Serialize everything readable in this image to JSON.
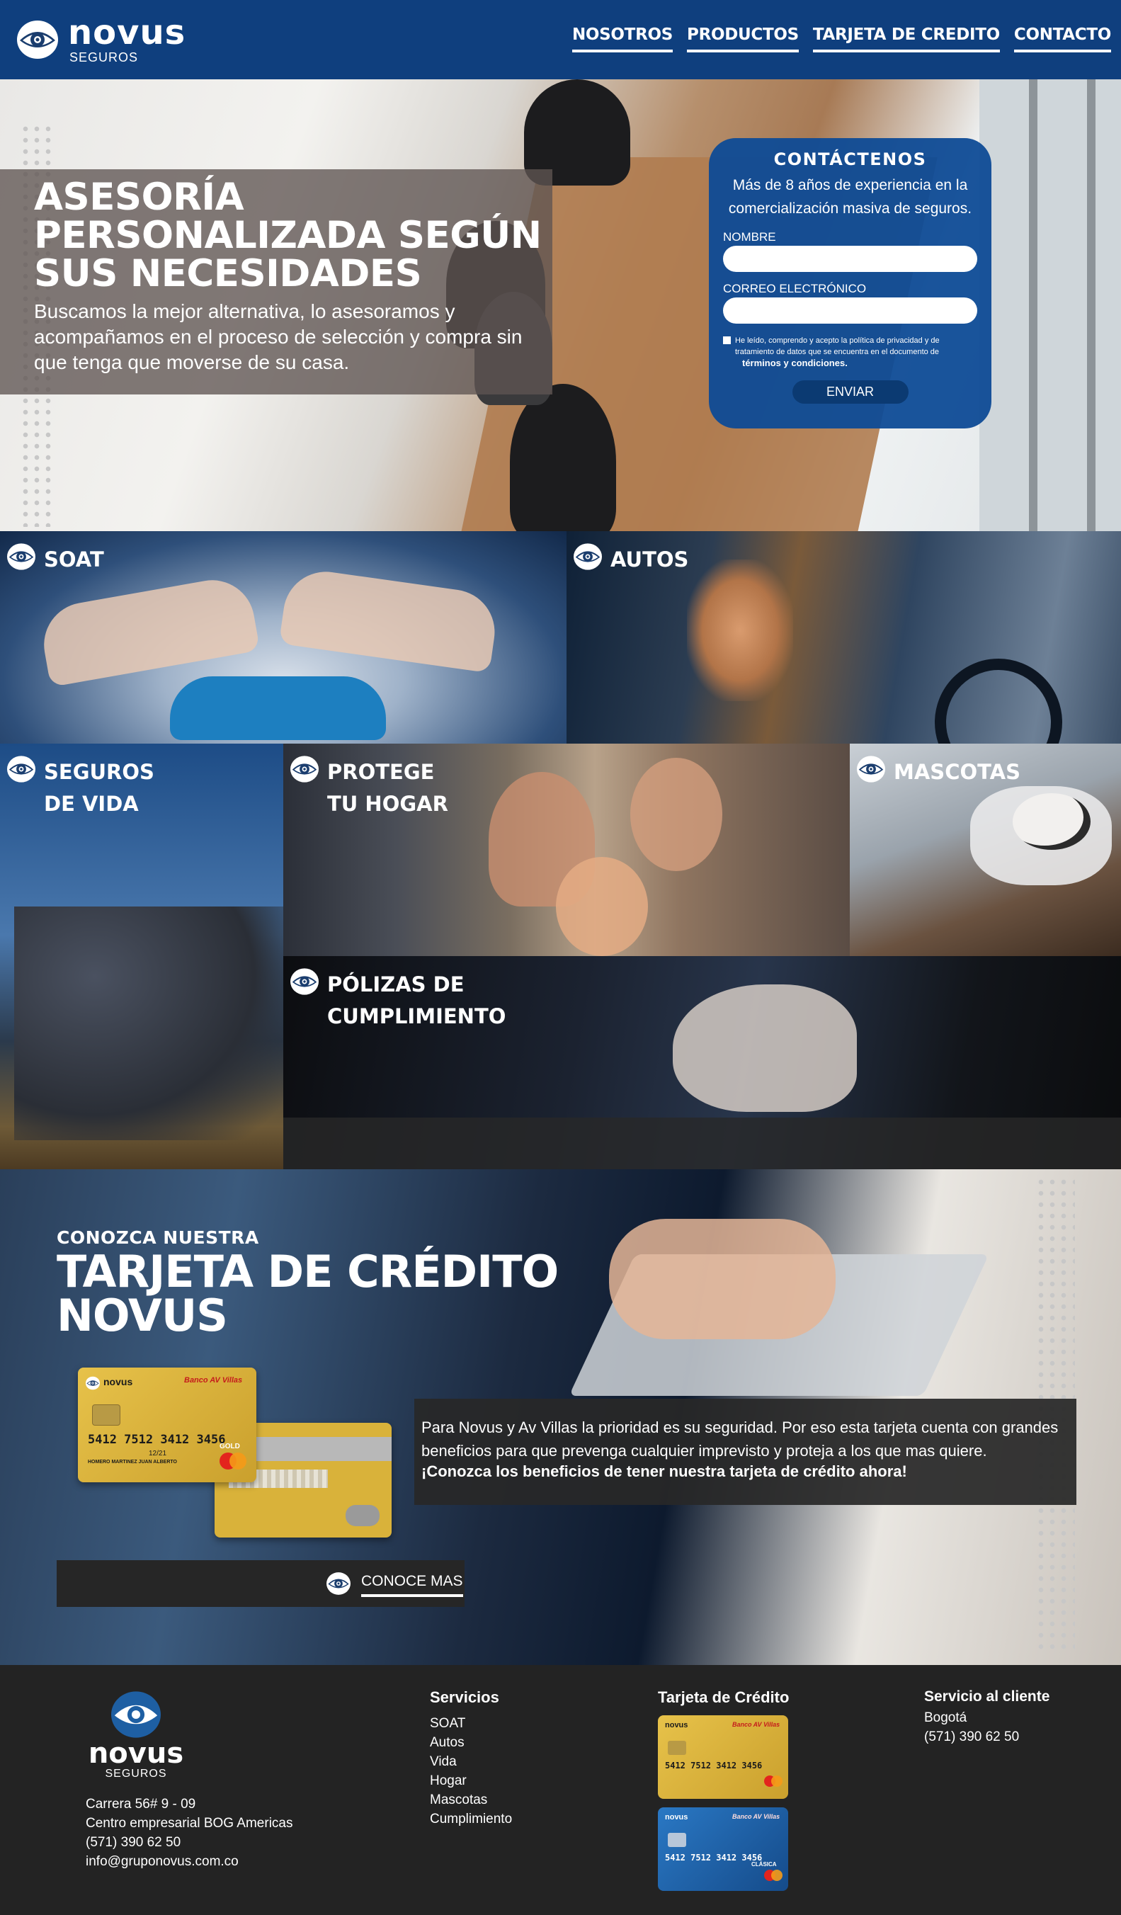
{
  "header": {
    "brand": "novus",
    "brand_sub": "SEGUROS",
    "nav": [
      "NOSOTROS",
      "PRODUCTOS",
      "TARJETA DE CREDITO",
      "CONTACTO"
    ]
  },
  "hero": {
    "title": "ASESORÍA PERSONALIZADA SEGÚN SUS NECESIDADES",
    "description": "Buscamos la mejor alternativa, lo asesoramos y acompañamos en el proceso de selección y compra sin que tenga que moverse de su casa."
  },
  "contact_form": {
    "title": "CONTÁCTENOS",
    "subtitle": "Más de 8 años de experiencia en la comercialización masiva de seguros.",
    "name_label": "NOMBRE",
    "email_label": "CORREO ELECTRÓNICO",
    "consent_text": "He leído, comprendo y acepto la política de privacidad y de tratamiento de datos que se encuentra en el documento de",
    "consent_link": "términos y condiciones.",
    "submit_label": "ENVIAR"
  },
  "products": {
    "soat": "SOAT",
    "autos": "AUTOS",
    "vida": [
      "SEGUROS",
      "DE VIDA"
    ],
    "hogar": [
      "PROTEGE",
      "TU HOGAR"
    ],
    "mascotas": "MASCOTAS",
    "cumplimiento": [
      "PÓLIZAS DE",
      "CUMPLIMIENTO"
    ]
  },
  "credit_card": {
    "pre_title": "CONOZCA NUESTRA",
    "title_line1": "TARJETA DE CRÉDITO",
    "title_line2": "NOVUS",
    "description": "Para Novus y Av Villas la prioridad es su seguridad. Por eso esta tarjeta cuenta con grandes beneficios para que prevenga cualquier imprevisto y proteja a los que mas quiere.",
    "cta_text": "¡Conozca los beneficios de tener nuestra tarjeta de crédito ahora!",
    "button_label": "CONOCE MAS",
    "card_number": "5412 7512 3412 3456",
    "card_expiry": "12/21",
    "card_holder": "HOMERO MARTINEZ JUAN ALBERTO",
    "card_tier_gold": "GOLD",
    "card_tier_classic": "CLÁSICA",
    "card_brand": "Banco AV Villas",
    "card_network": "mastercard"
  },
  "footer": {
    "brand": "novus",
    "brand_sub": "SEGUROS",
    "address_lines": [
      "Carrera 56# 9 - 09",
      "Centro empresarial BOG Americas",
      "(571) 390 62 50",
      "info@gruponovus.com.co"
    ],
    "servicios_title": "Servicios",
    "servicios": [
      "SOAT",
      "Autos",
      "Vida",
      "Hogar",
      "Mascotas",
      "Cumplimiento"
    ],
    "tarjeta_title": "Tarjeta de Crédito",
    "cliente_title": "Servicio al cliente",
    "cliente_lines": [
      "Bogotá",
      "(571) 390 62 50"
    ]
  },
  "colors": {
    "primary": "#0f3f7e",
    "form_bg": "#0e4b96",
    "dark": "#232323",
    "gold_card": "#d9b23a",
    "blue_card": "#1b5fa8"
  }
}
